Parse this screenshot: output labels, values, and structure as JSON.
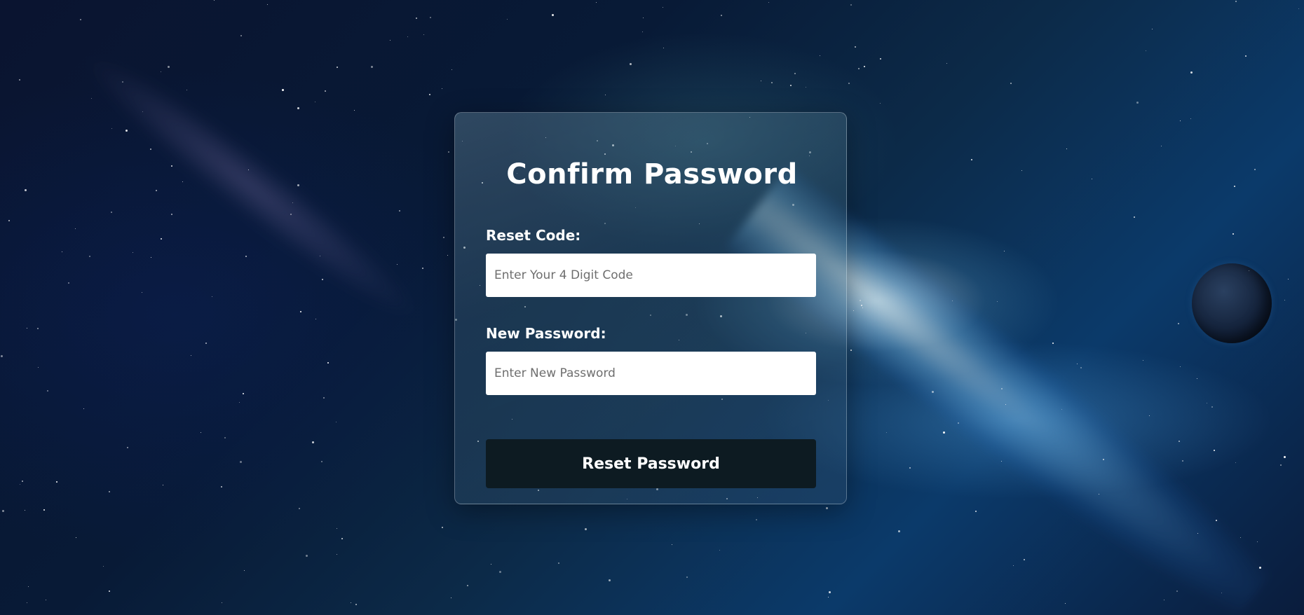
{
  "form": {
    "title": "Confirm Password",
    "reset_code_label": "Reset Code:",
    "reset_code_placeholder": "Enter Your 4 Digit Code",
    "reset_code_value": "",
    "new_password_label": "New Password:",
    "new_password_placeholder": "Enter New Password",
    "new_password_value": "",
    "submit_label": "Reset Password"
  },
  "theme": {
    "button_color": "#0d1b22",
    "input_background": "#ffffff",
    "text_color": "#ffffff"
  }
}
